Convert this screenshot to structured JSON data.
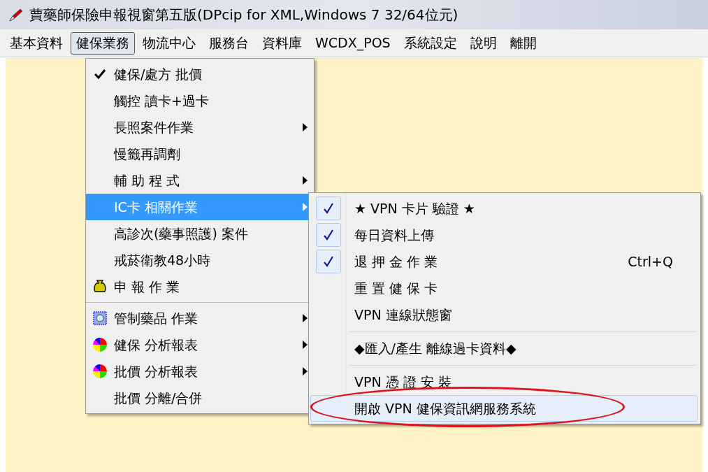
{
  "window": {
    "title": "蕒藥師保險申報視窗第五版(DPcip for XML,Windows 7 32/64位元)"
  },
  "menu_bar": [
    {
      "label": "基本資料",
      "selected": false
    },
    {
      "label": "健保業務",
      "selected": true
    },
    {
      "label": "物流中心",
      "selected": false
    },
    {
      "label": "服務台",
      "selected": false
    },
    {
      "label": "資料庫",
      "selected": false
    },
    {
      "label": "WCDX_POS",
      "selected": false
    },
    {
      "label": "系統設定",
      "selected": false
    },
    {
      "label": "說明",
      "selected": false
    },
    {
      "label": "離開",
      "selected": false
    }
  ],
  "menu": [
    {
      "kind": "item",
      "label": "健保/處方 批價",
      "checked": true,
      "submenu": false,
      "selected": false
    },
    {
      "kind": "item",
      "label": "觸控 讀卡+過卡",
      "checked": false,
      "submenu": false,
      "selected": false
    },
    {
      "kind": "item",
      "label": "長照案件作業",
      "checked": false,
      "submenu": true,
      "selected": false
    },
    {
      "kind": "item",
      "label": "慢籤再調劑",
      "checked": false,
      "submenu": false,
      "selected": false
    },
    {
      "kind": "item",
      "label": "輔 助 程 式",
      "checked": false,
      "submenu": true,
      "selected": false
    },
    {
      "kind": "item",
      "label": "IC卡 相關作業",
      "checked": false,
      "submenu": true,
      "selected": true
    },
    {
      "kind": "item",
      "label": "高診次(藥事照護) 案件",
      "checked": false,
      "submenu": false,
      "selected": false
    },
    {
      "kind": "item",
      "label": "戒菸衛教48小時",
      "checked": false,
      "submenu": false,
      "selected": false
    },
    {
      "kind": "bag",
      "label": "申 報 作 業",
      "checked": false,
      "submenu": false,
      "selected": false
    },
    {
      "kind": "separator"
    },
    {
      "kind": "grid",
      "label": "管制藥品 作業",
      "checked": false,
      "submenu": true,
      "selected": false
    },
    {
      "kind": "pie",
      "label": "健保 分析報表",
      "checked": false,
      "submenu": true,
      "selected": false
    },
    {
      "kind": "pie",
      "label": "批價 分析報表",
      "checked": false,
      "submenu": true,
      "selected": false
    },
    {
      "kind": "item",
      "label": "批價 分離/合併",
      "checked": false,
      "submenu": false,
      "selected": false
    }
  ],
  "submenu": [
    {
      "kind": "item",
      "label": "★ VPN 卡片 驗證 ★",
      "checked": true,
      "selected": false
    },
    {
      "kind": "item",
      "label": "每日資料上傳",
      "checked": true,
      "selected": false
    },
    {
      "kind": "item",
      "label": "退 押 金 作 業",
      "checked": true,
      "selected": false,
      "shortcut": "Ctrl+Q"
    },
    {
      "kind": "item",
      "label": "重 置 健 保 卡",
      "checked": false,
      "selected": false
    },
    {
      "kind": "item",
      "label": "VPN 連線狀態窗",
      "checked": false,
      "selected": false
    },
    {
      "kind": "separator"
    },
    {
      "kind": "item",
      "label": "◆匯入/產生 離線過卡資料◆",
      "checked": false,
      "selected": false
    },
    {
      "kind": "separator"
    },
    {
      "kind": "item",
      "label": "VPN 憑 證 安 裝",
      "checked": false,
      "selected": false
    },
    {
      "kind": "item",
      "label": "開啟 VPN 健保資訊網服務系統",
      "checked": false,
      "selected": true,
      "circled": true
    }
  ]
}
